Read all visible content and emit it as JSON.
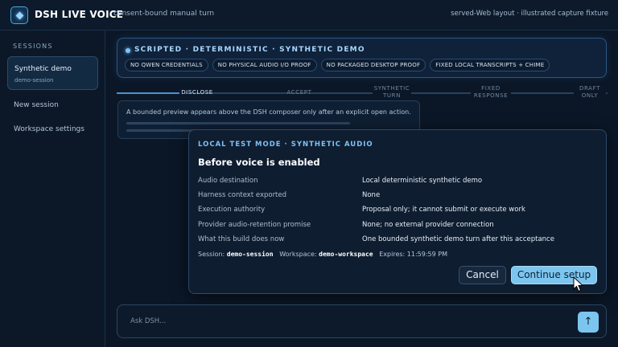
{
  "header": {
    "title": "DSH LIVE VOICE",
    "subtitle": "consent-bound manual turn",
    "right_text": "served-Web layout · illustrated capture fixture"
  },
  "sidebar": {
    "heading": "SESSIONS",
    "active_session": {
      "name": "Synthetic demo",
      "id": "demo-session"
    },
    "links": [
      "New session",
      "Workspace settings"
    ]
  },
  "banner": {
    "title": "SCRIPTED · DETERMINISTIC · SYNTHETIC DEMO",
    "chips": [
      "NO QWEN CREDENTIALS",
      "NO PHYSICAL AUDIO I/O PROOF",
      "NO PACKAGED DESKTOP PROOF",
      "FIXED LOCAL TRANSCRIPTS + CHIME"
    ]
  },
  "steps": [
    {
      "label": "DISCLOSE",
      "active": true
    },
    {
      "label": "ACCEPT",
      "active": false
    },
    {
      "label": "SYNTHETIC\nTURN",
      "active": false
    },
    {
      "label": "FIXED\nRESPONSE",
      "active": false
    },
    {
      "label": "DRAFT\nONLY",
      "active": false
    }
  ],
  "preview": {
    "text": "A bounded preview appears above the DSH composer only after an explicit open action."
  },
  "modal": {
    "badge": "LOCAL TEST MODE · SYNTHETIC AUDIO",
    "title": "Before voice is enabled",
    "rows": [
      {
        "key": "Audio destination",
        "value": "Local deterministic synthetic demo"
      },
      {
        "key": "Harness context exported",
        "value": "None"
      },
      {
        "key": "Execution authority",
        "value": "Proposal only; it cannot submit or execute work"
      },
      {
        "key": "Provider audio-retention promise",
        "value": "None; no external provider connection"
      },
      {
        "key": "What this build does now",
        "value": "One bounded synthetic demo turn after this acceptance"
      }
    ],
    "meta": {
      "session_label": "Session:",
      "session_value": "demo-session",
      "workspace_label": "Workspace:",
      "workspace_value": "demo-workspace",
      "expires_label": "Expires:",
      "expires_value": "11:59:59 PM"
    },
    "cancel_label": "Cancel",
    "continue_label": "Continue setup"
  },
  "composer": {
    "placeholder": "Ask DSH...",
    "send_icon": "arrow-up-icon"
  },
  "colors": {
    "accent": "#7cc5ef",
    "background": "#0b1727",
    "panel": "#0e1d30"
  }
}
